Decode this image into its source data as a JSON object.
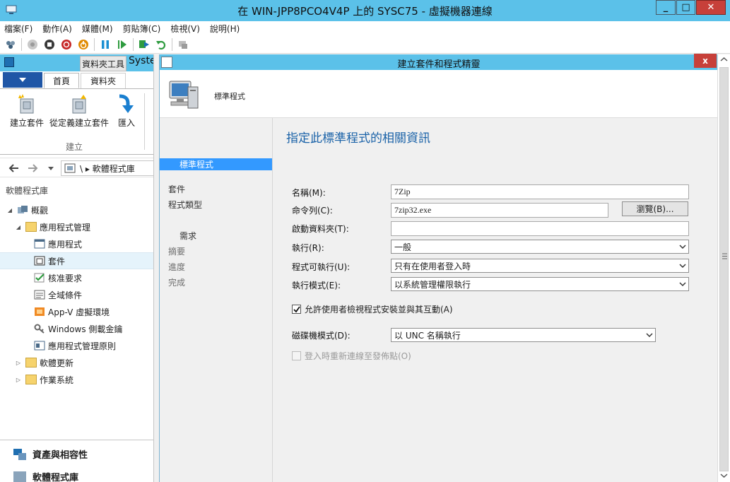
{
  "vm": {
    "title": "在 WIN-JPP8PCO4V4P 上的 SYSC75 - 虛擬機器連線",
    "minimize": "_",
    "maximize": "□",
    "close": "✕"
  },
  "menu": [
    "檔案(F)",
    "動作(A)",
    "媒體(M)",
    "剪貼簿(C)",
    "檢視(V)",
    "說明(H)"
  ],
  "console": {
    "contextual_tab": "資料夾工具",
    "title_fragment": "Syste",
    "tabs": {
      "home": "首頁",
      "folder": "資料夾"
    },
    "ribbon": {
      "create_package": "建立套件",
      "create_from_definition": "從定義建立套件",
      "import": "匯入",
      "group_label": "建立"
    },
    "address": "\\  ▸  軟體程式庫",
    "library_header": "軟體程式庫",
    "tree": [
      {
        "label": "概觀",
        "level": 0,
        "expander": "◢"
      },
      {
        "label": "應用程式管理",
        "level": 1,
        "expander": "◢"
      },
      {
        "label": "應用程式",
        "level": 2,
        "expander": ""
      },
      {
        "label": "套件",
        "level": 2,
        "expander": "",
        "selected": true
      },
      {
        "label": "核准要求",
        "level": 2,
        "expander": ""
      },
      {
        "label": "全域條件",
        "level": 2,
        "expander": ""
      },
      {
        "label": "App-V 虛擬環境",
        "level": 2,
        "expander": ""
      },
      {
        "label": "Windows 側載金鑰",
        "level": 2,
        "expander": ""
      },
      {
        "label": "應用程式管理原則",
        "level": 2,
        "expander": ""
      },
      {
        "label": "軟體更新",
        "level": 1,
        "expander": "▷"
      },
      {
        "label": "作業系統",
        "level": 1,
        "expander": "▷"
      }
    ],
    "bottom": {
      "assets": "資產與相容性",
      "software_library": "軟體程式庫"
    }
  },
  "wizard": {
    "title": "建立套件和程式精靈",
    "close": "x",
    "header_text": "標準程式",
    "steps": {
      "package": "套件",
      "program_type": "程式類型",
      "standard_program": "標準程式",
      "requirements": "需求",
      "summary": "摘要",
      "progress": "進度",
      "completion": "完成"
    },
    "heading": "指定此標準程式的相關資訊",
    "fields": {
      "name_label": "名稱(M):",
      "name_value": "7Zip",
      "command_label": "命令列(C):",
      "command_value": "7zip32.exe",
      "browse": "瀏覽(B)...",
      "startdir_label": "啟動資料夾(T):",
      "startdir_value": "",
      "run_label": "執行(R):",
      "run_value": "一般",
      "canrun_label": "程式可執行(U):",
      "canrun_value": "只有在使用者登入時",
      "runmode_label": "執行模式(E):",
      "runmode_value": "以系統管理權限執行",
      "allow_interact": "允許使用者檢視程式安裝並與其互動(A)",
      "allow_checked": true,
      "drive_label": "磁碟機模式(D):",
      "drive_value": "以 UNC 名稱執行",
      "reconnect": "登入時重新連線至發佈點(O)",
      "reconnect_checked": false
    }
  }
}
